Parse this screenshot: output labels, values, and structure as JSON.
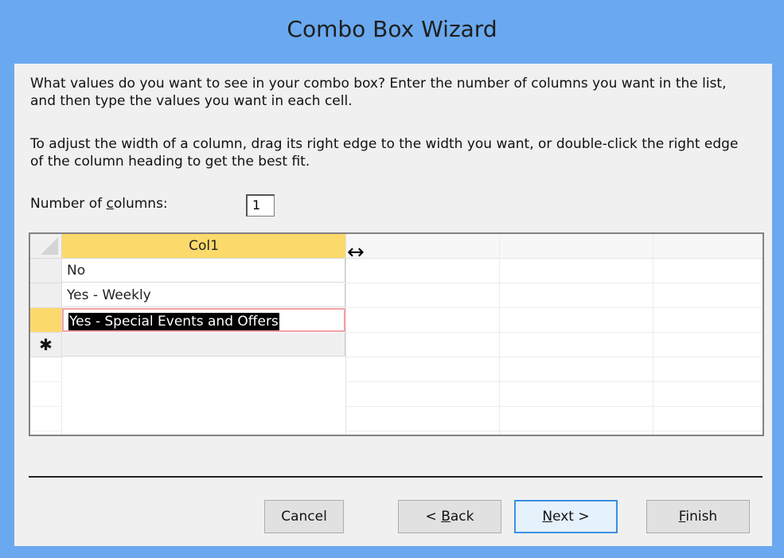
{
  "window": {
    "title": "Combo Box Wizard"
  },
  "instructions": {
    "p1": "What values do you want to see in your combo box? Enter the number of columns you want in the list, and then type the values you want in each cell.",
    "p2": "To adjust the width of a column, drag its right edge to the width you want, or double-click the right edge of the column heading to get the best fit."
  },
  "columns_field": {
    "label_pre": "Number of ",
    "label_mnemonic": "c",
    "label_post": "olumns:",
    "value": "1"
  },
  "grid": {
    "header": "Col1",
    "rows": [
      "No",
      "Yes - Weekly",
      "Yes - Special Events and Offers"
    ],
    "new_row_symbol": "✱"
  },
  "buttons": {
    "cancel": "Cancel",
    "back_pre": "< ",
    "back_mn": "B",
    "back_post": "ack",
    "next_pre": "",
    "next_mn": "N",
    "next_post": "ext >",
    "finish_pre": "",
    "finish_mn": "F",
    "finish_post": "inish"
  },
  "icons": {
    "resize_cursor": "horizontal-resize-cursor-icon"
  }
}
